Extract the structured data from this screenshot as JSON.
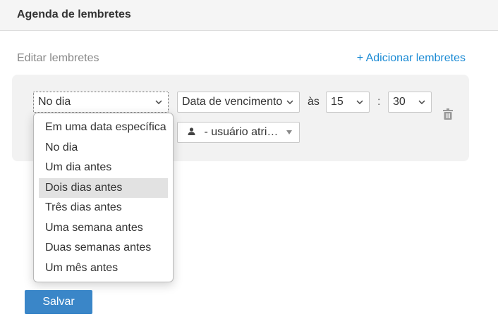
{
  "header": {
    "title": "Agenda de lembretes"
  },
  "section": {
    "label": "Editar lembretes",
    "add_link": "+ Adicionar lembretes"
  },
  "reminder": {
    "when_value": "No dia",
    "date_field_value": "Data de vencimento",
    "at_label": "às",
    "hour_value": "15",
    "time_separator": ":",
    "minute_value": "30",
    "user_value": "- usuário atribuído"
  },
  "dropdown": {
    "options": [
      "Em uma data específica",
      "No dia",
      "Um dia antes",
      "Dois dias antes",
      "Três dias antes",
      "Uma semana antes",
      "Duas semanas antes",
      "Um mês antes"
    ],
    "highlighted": "Dois dias antes"
  },
  "buttons": {
    "save_label": "Salvar"
  },
  "colors": {
    "accent": "#1a8ad4",
    "save_button": "#3a86c8",
    "panel": "#f2f2f2",
    "hover": "#e2e2e2"
  },
  "icons": {
    "chevron": "chevron-down-icon",
    "trash": "trash-icon",
    "user": "user-icon",
    "caret": "caret-down-icon"
  }
}
